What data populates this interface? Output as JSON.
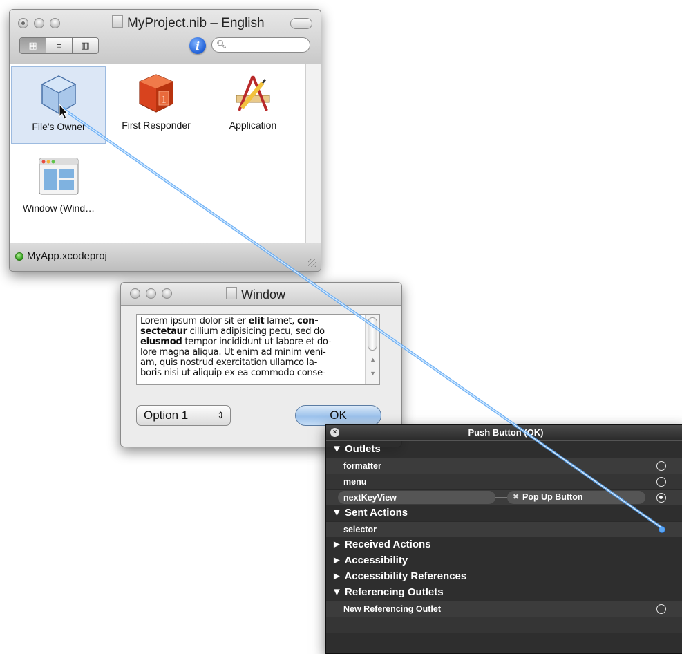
{
  "nib_window": {
    "title": "MyProject.nib – English",
    "view_modes": [
      "icon-view",
      "list-view",
      "column-view"
    ],
    "search_placeholder": "",
    "objects": [
      {
        "label": "File's Owner",
        "icon": "cube-icon",
        "selected": true
      },
      {
        "label": "First Responder",
        "icon": "first-responder-icon",
        "selected": false
      },
      {
        "label": "Application",
        "icon": "application-icon",
        "selected": false
      },
      {
        "label": "Window (Wind…",
        "icon": "window-icon",
        "selected": false
      }
    ],
    "status_project": "MyApp.xcodeproj"
  },
  "window": {
    "title": "Window",
    "text_lines": [
      "Lorem ipsum dolor sit er elit lamet, con-",
      "sectetaur cillium adipisicing pecu, sed do",
      "eiusmod tempor incididunt ut labore et do-",
      "lore magna aliqua. Ut enim ad minim veni-",
      "am, quis nostrud exercitation ullamco la-",
      "boris nisi ut aliquip ex ea commodo conse-"
    ],
    "popup_value": "Option 1",
    "ok_label": "OK"
  },
  "inspector": {
    "title": "Push Button (OK)",
    "outlets_header": "▼ Outlets",
    "outlets": [
      "formatter",
      "menu",
      "nextKeyView"
    ],
    "connected_to": "Pop Up Button",
    "sent_actions_header": "▼ Sent Actions",
    "sent_action": "selector",
    "received_actions_header": "► Received Actions",
    "accessibility_header": "► Accessibility",
    "accessibility_refs_header": "► Accessibility References",
    "referencing_outlets_header": "▼ Referencing Outlets",
    "new_referencing_outlet": "New Referencing Outlet"
  },
  "colors": {
    "selection_blue": "#5aa6f5",
    "panel_dark": "#1e1e1e"
  }
}
